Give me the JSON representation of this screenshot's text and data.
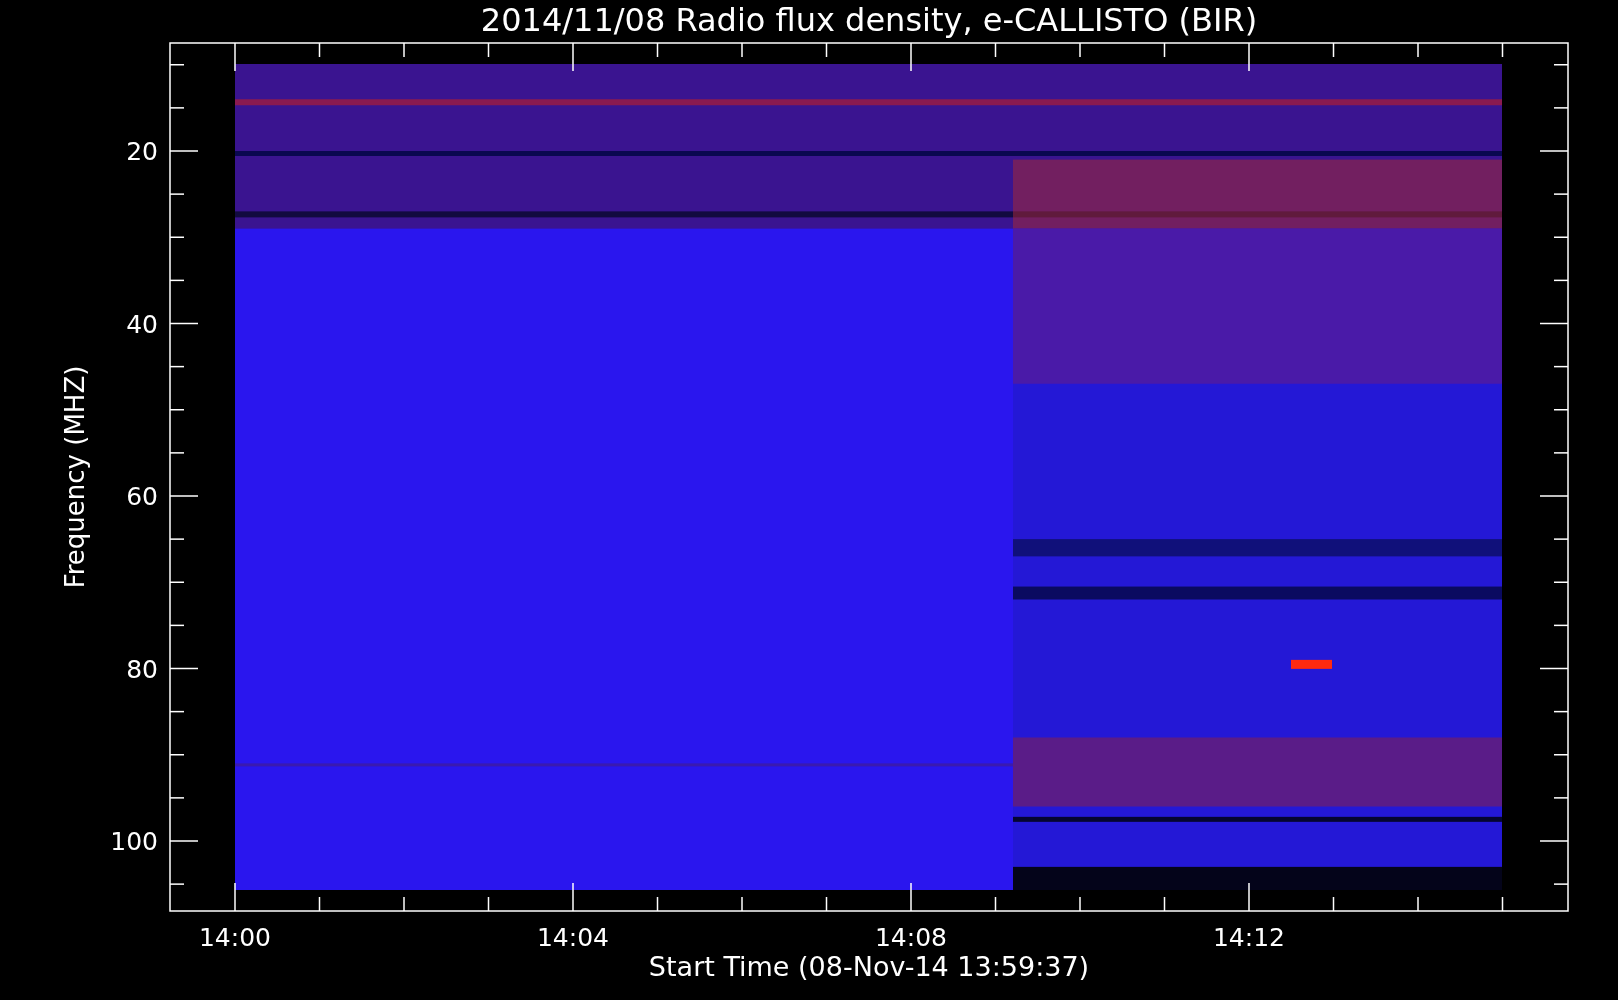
{
  "title": "2014/11/08  Radio flux density, e-CALLISTO (BIR)",
  "y_axis": {
    "label": "Frequency (MHZ)",
    "ticks": [
      "20",
      "40",
      "60",
      "80",
      "100"
    ]
  },
  "x_axis": {
    "label": "Start Time (08-Nov-14 13:59:37)",
    "ticks": [
      "14:00",
      "14:04",
      "14:08",
      "14:12"
    ]
  }
}
